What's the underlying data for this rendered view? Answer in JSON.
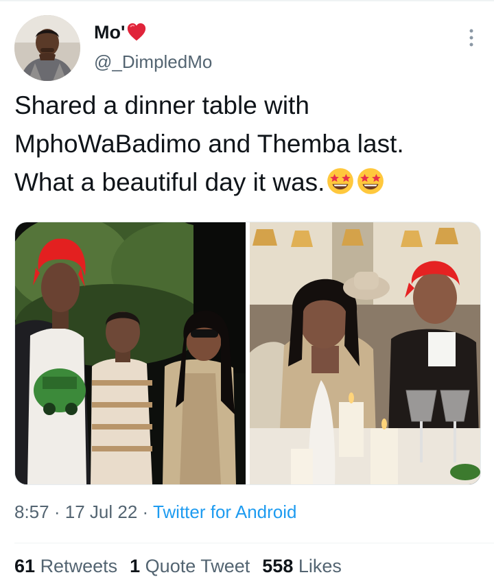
{
  "tweet": {
    "author": {
      "display_name": "Mo'",
      "handle": "@_DimpledMo",
      "name_emoji_icon": "red-heart-icon"
    },
    "text_lines": [
      "Shared a dinner table with",
      "MphoWaBadimo and Themba last.",
      "What a beautiful day it was."
    ],
    "trailing_emoji_icon": "star-struck-emoji-icon",
    "timestamp": {
      "time": "8:57",
      "separator": "·",
      "date": "17 Jul 22",
      "source": "Twitter for Android"
    },
    "stats": {
      "retweets_count": "61",
      "retweets_label": "Retweets",
      "quotes_count": "1",
      "quotes_label": "Quote Tweet",
      "likes_count": "558",
      "likes_label": "Likes"
    }
  },
  "colors": {
    "text": "#0f1419",
    "secondary": "#536471",
    "link": "#1d9bf0",
    "divider": "#eff3f4"
  }
}
